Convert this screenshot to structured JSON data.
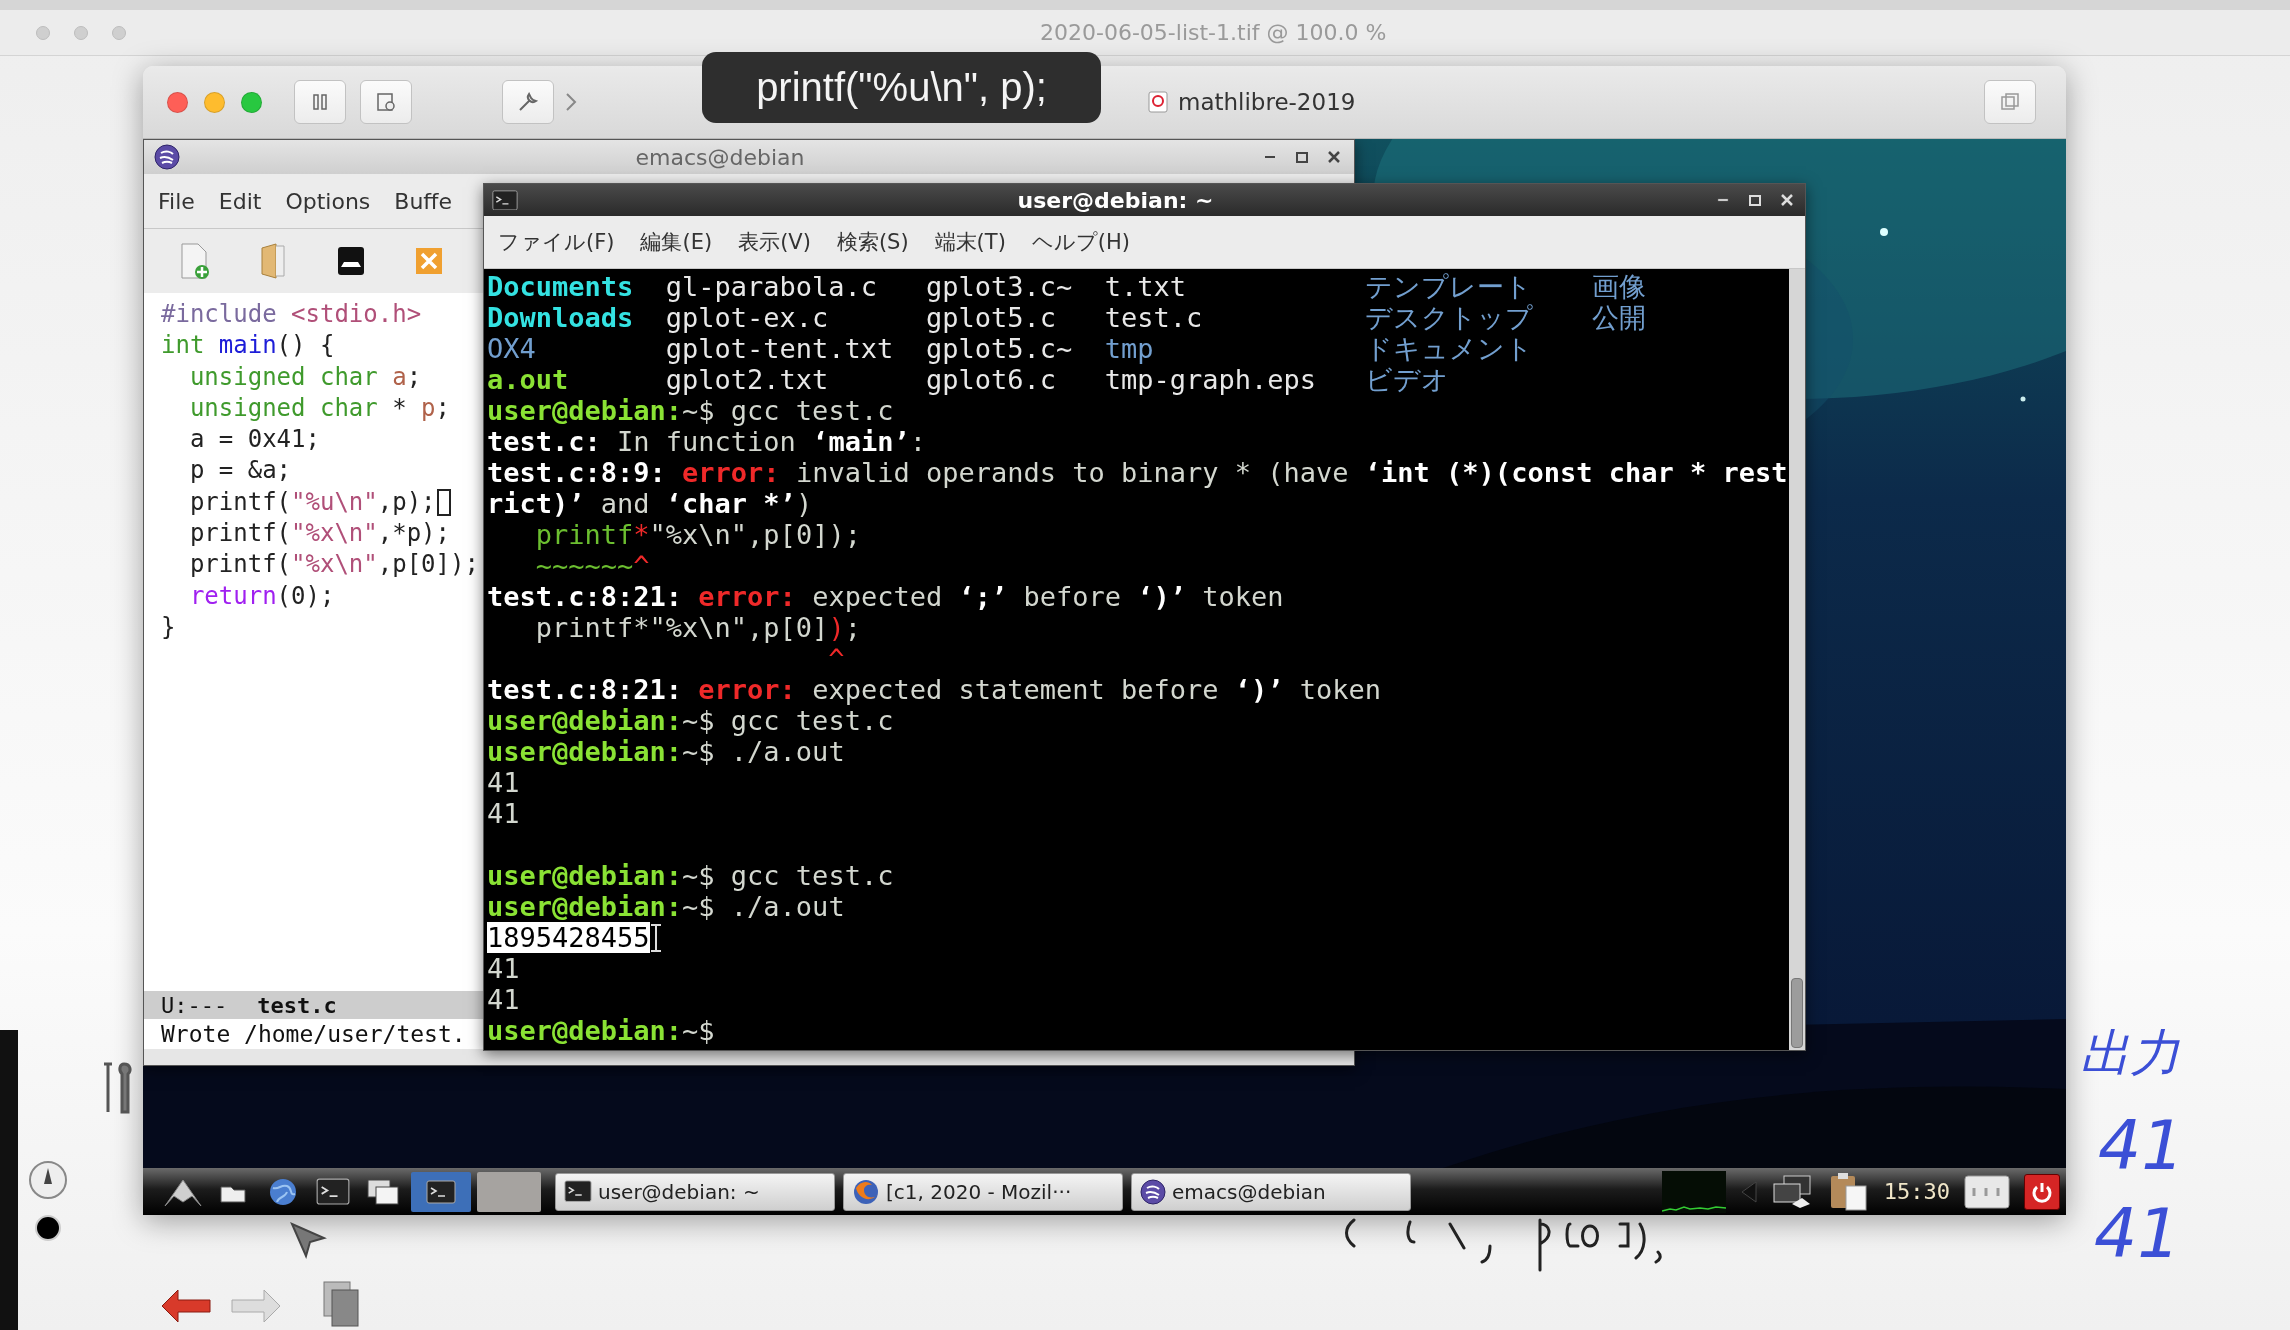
{
  "app": {
    "title": "2020-06-05-list-1.tif @ 100.0 %"
  },
  "vm_window": {
    "tooltip": "printf(\"%u\\n\", p);",
    "tab_title": "mathlibre-2019"
  },
  "emacs": {
    "title": "emacs@debian",
    "menu": [
      "File",
      "Edit",
      "Options",
      "Buffe"
    ],
    "code": [
      {
        "cursor": false,
        "segments": [
          {
            "text": "#include ",
            "kind": "preproc"
          },
          {
            "text": "<stdio.h>",
            "kind": "string"
          }
        ]
      },
      {
        "cursor": false,
        "segments": [
          {
            "text": "int ",
            "kind": "type"
          },
          {
            "text": "main",
            "kind": "func"
          },
          {
            "text": "() {",
            "kind": "plain"
          }
        ]
      },
      {
        "cursor": false,
        "segments": [
          {
            "text": "  unsigned char ",
            "kind": "type"
          },
          {
            "text": "a",
            "kind": "var"
          },
          {
            "text": ";",
            "kind": "plain"
          }
        ]
      },
      {
        "cursor": false,
        "segments": [
          {
            "text": "  unsigned char",
            "kind": "type"
          },
          {
            "text": " * ",
            "kind": "plain"
          },
          {
            "text": "p",
            "kind": "var"
          },
          {
            "text": ";",
            "kind": "plain"
          }
        ]
      },
      {
        "cursor": false,
        "segments": [
          {
            "text": "  a = 0x41;",
            "kind": "plain"
          }
        ]
      },
      {
        "cursor": false,
        "segments": [
          {
            "text": "  p = &a;",
            "kind": "plain"
          }
        ]
      },
      {
        "cursor": true,
        "segments": [
          {
            "text": "  printf(",
            "kind": "plain"
          },
          {
            "text": "\"%u\\n\"",
            "kind": "string"
          },
          {
            "text": ",p);",
            "kind": "plain"
          }
        ]
      },
      {
        "cursor": false,
        "segments": [
          {
            "text": "  printf(",
            "kind": "plain"
          },
          {
            "text": "\"%x\\n\"",
            "kind": "string"
          },
          {
            "text": ",*p);",
            "kind": "plain"
          }
        ]
      },
      {
        "cursor": false,
        "segments": [
          {
            "text": "  printf(",
            "kind": "plain"
          },
          {
            "text": "\"%x\\n\"",
            "kind": "string"
          },
          {
            "text": ",p[0]);",
            "kind": "plain"
          }
        ]
      },
      {
        "cursor": false,
        "segments": [
          {
            "text": "  return",
            "kind": "keyword"
          },
          {
            "text": "(0);",
            "kind": "plain"
          }
        ]
      },
      {
        "cursor": false,
        "segments": [
          {
            "text": "}",
            "kind": "plain"
          }
        ]
      }
    ],
    "mode_line": {
      "status": "U:---",
      "buffer": "test.c"
    },
    "echo": "Wrote /home/user/test."
  },
  "terminal": {
    "title": "user@debian: ~",
    "menu": [
      "ファイル(F)",
      "編集(E)",
      "表示(V)",
      "検索(S)",
      "端末(T)",
      "ヘルプ(H)"
    ],
    "listing": [
      [
        {
          "text": "Documents",
          "kind": "dir"
        },
        {
          "text": "gl-parabola.c",
          "kind": "file"
        },
        {
          "text": "gplot3.c~",
          "kind": "file"
        },
        {
          "text": "t.txt",
          "kind": "file"
        },
        {
          "text": "テンプレート",
          "kind": "other"
        },
        {
          "text": "画像",
          "kind": "other"
        }
      ],
      [
        {
          "text": "Downloads",
          "kind": "dir"
        },
        {
          "text": "gplot-ex.c",
          "kind": "file"
        },
        {
          "text": "gplot5.c",
          "kind": "file"
        },
        {
          "text": "test.c",
          "kind": "file"
        },
        {
          "text": "デスクトップ",
          "kind": "other"
        },
        {
          "text": "公開",
          "kind": "other"
        }
      ],
      [
        {
          "text": "OX4",
          "kind": "other"
        },
        {
          "text": "gplot-tent.txt",
          "kind": "file"
        },
        {
          "text": "gplot5.c~",
          "kind": "file"
        },
        {
          "text": "tmp",
          "kind": "other"
        },
        {
          "text": "ドキュメント",
          "kind": "other"
        }
      ],
      [
        {
          "text": "a.out",
          "kind": "exec"
        },
        {
          "text": "gplot2.txt",
          "kind": "file"
        },
        {
          "text": "gplot6.c",
          "kind": "file"
        },
        {
          "text": "tmp-graph.eps",
          "kind": "file"
        },
        {
          "text": "ビデオ",
          "kind": "other"
        }
      ]
    ],
    "lines": [
      {
        "kind": "text",
        "segments": [
          {
            "text": "user@debian:",
            "kind": "prompt"
          },
          {
            "text": "~$ gcc test.c",
            "kind": "plain"
          }
        ]
      },
      {
        "kind": "text",
        "segments": [
          {
            "text": "test.c:",
            "kind": "bold"
          },
          {
            "text": " In function ",
            "kind": "plain"
          },
          {
            "text": "‘main’",
            "kind": "bold"
          },
          {
            "text": ":",
            "kind": "plain"
          }
        ]
      },
      {
        "kind": "text",
        "segments": [
          {
            "text": "test.c:8:9: ",
            "kind": "bold"
          },
          {
            "text": "error: ",
            "kind": "error"
          },
          {
            "text": "invalid operands to binary * (have ",
            "kind": "plain"
          },
          {
            "text": "‘int (*)(const char * rest",
            "kind": "bold"
          }
        ]
      },
      {
        "kind": "text",
        "segments": [
          {
            "text": "rict)’",
            "kind": "bold"
          },
          {
            "text": " and ",
            "kind": "plain"
          },
          {
            "text": "‘char *’",
            "kind": "bold"
          },
          {
            "text": ")",
            "kind": "plain"
          }
        ]
      },
      {
        "kind": "text",
        "segments": [
          {
            "text": "   printf",
            "kind": "green"
          },
          {
            "text": "*",
            "kind": "red"
          },
          {
            "text": "\"%x\\n\",p[0]);",
            "kind": "plain"
          }
        ]
      },
      {
        "kind": "text",
        "segments": [
          {
            "text": "   ~~~~~~",
            "kind": "green"
          },
          {
            "text": "^",
            "kind": "red"
          }
        ]
      },
      {
        "kind": "text",
        "segments": [
          {
            "text": "test.c:8:21: ",
            "kind": "bold"
          },
          {
            "text": "error: ",
            "kind": "error"
          },
          {
            "text": "expected ",
            "kind": "plain"
          },
          {
            "text": "‘;’",
            "kind": "bold"
          },
          {
            "text": " before ",
            "kind": "plain"
          },
          {
            "text": "‘)’",
            "kind": "bold"
          },
          {
            "text": " token",
            "kind": "plain"
          }
        ]
      },
      {
        "kind": "text",
        "segments": [
          {
            "text": "   printf*\"%x\\n\",p[0]",
            "kind": "plain"
          },
          {
            "text": ")",
            "kind": "red"
          },
          {
            "text": ";",
            "kind": "plain"
          }
        ]
      },
      {
        "kind": "text",
        "segments": [
          {
            "text": "                     ^",
            "kind": "red"
          }
        ]
      },
      {
        "kind": "text",
        "segments": [
          {
            "text": "test.c:8:21: ",
            "kind": "bold"
          },
          {
            "text": "error: ",
            "kind": "error"
          },
          {
            "text": "expected statement before ",
            "kind": "plain"
          },
          {
            "text": "‘)’",
            "kind": "bold"
          },
          {
            "text": " token",
            "kind": "plain"
          }
        ]
      },
      {
        "kind": "text",
        "segments": [
          {
            "text": "user@debian:",
            "kind": "prompt"
          },
          {
            "text": "~$ gcc test.c",
            "kind": "plain"
          }
        ]
      },
      {
        "kind": "text",
        "segments": [
          {
            "text": "user@debian:",
            "kind": "prompt"
          },
          {
            "text": "~$ ./a.out",
            "kind": "plain"
          }
        ]
      },
      {
        "kind": "text",
        "segments": [
          {
            "text": "41",
            "kind": "plain"
          }
        ]
      },
      {
        "kind": "text",
        "segments": [
          {
            "text": "41",
            "kind": "plain"
          }
        ]
      },
      {
        "kind": "blank"
      },
      {
        "kind": "text",
        "segments": [
          {
            "text": "user@debian:",
            "kind": "prompt"
          },
          {
            "text": "~$ gcc test.c",
            "kind": "plain"
          }
        ]
      },
      {
        "kind": "text",
        "segments": [
          {
            "text": "user@debian:",
            "kind": "prompt"
          },
          {
            "text": "~$ ./a.out",
            "kind": "plain"
          }
        ]
      },
      {
        "kind": "text",
        "segments": [
          {
            "text": "1895428455",
            "kind": "selection"
          }
        ]
      },
      {
        "kind": "text",
        "segments": [
          {
            "text": "41",
            "kind": "plain"
          }
        ]
      },
      {
        "kind": "text",
        "segments": [
          {
            "text": "41",
            "kind": "plain"
          }
        ]
      },
      {
        "kind": "text",
        "segments": [
          {
            "text": "user@debian:",
            "kind": "prompt"
          },
          {
            "text": "~$",
            "kind": "plain"
          }
        ]
      }
    ]
  },
  "taskbar": {
    "tasks": [
      {
        "label": "user@debian: ~",
        "kind": "terminal"
      },
      {
        "label": "[c1, 2020 - Mozil···",
        "kind": "browser"
      },
      {
        "label": "emacs@debian",
        "kind": "emacs"
      }
    ],
    "clock": "15:30"
  },
  "notes": [
    "出力",
    "41",
    "41"
  ]
}
